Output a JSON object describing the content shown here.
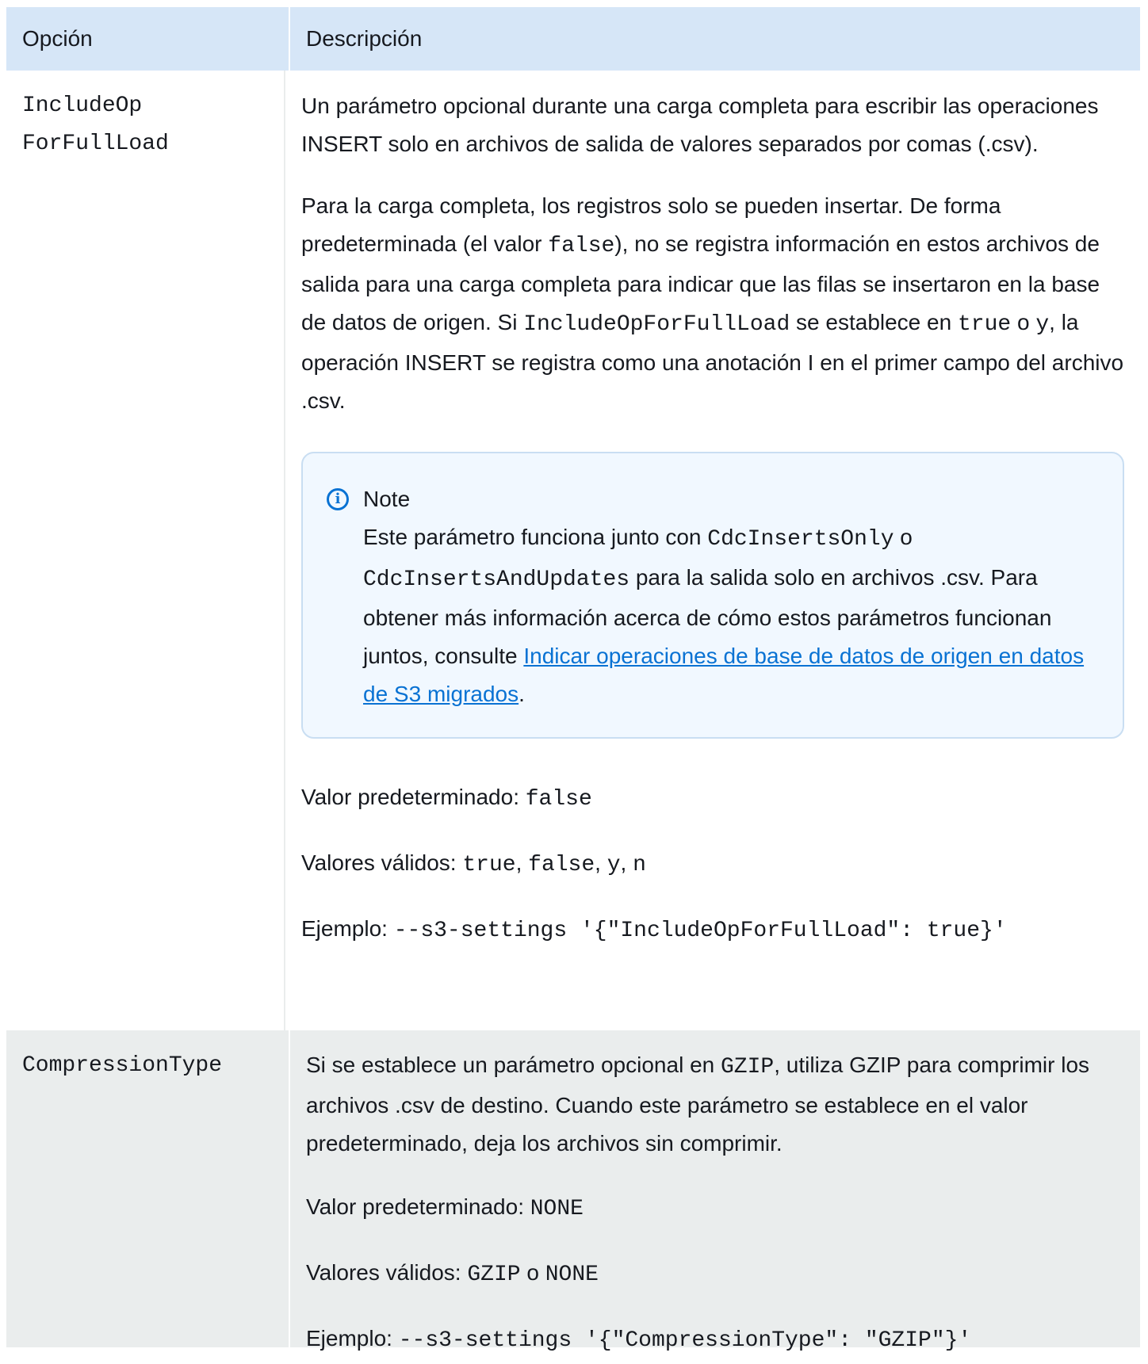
{
  "table": {
    "headers": {
      "option": "Opción",
      "description": "Descripción"
    },
    "rows": [
      {
        "option_line1": "IncludeOp",
        "option_line2": "ForFullLoad",
        "p1": "Un parámetro opcional durante una carga completa para escribir las operaciones INSERT solo en archivos de salida de valores separados por comas (.csv).",
        "p2": {
          "t1": "Para la carga completa, los registros solo se pueden insertar. De forma predeterminada (el valor ",
          "c1": "false",
          "t2": "), no se registra información en estos archivos de salida para una carga completa para indicar que las filas se insertaron en la base de datos de origen. Si ",
          "c2": "IncludeOpForFullLoad",
          "t3": " se establece en ",
          "c3": "true",
          "t4": " o ",
          "c4": "y",
          "t5": ", la operación INSERT se registra como una anotación I en el primer campo del archivo .csv."
        },
        "note": {
          "title": "Note",
          "t1": "Este parámetro funciona junto con ",
          "c1": "CdcInsertsOnly",
          "t2": " o ",
          "c2": "CdcInsertsAndUpdates",
          "t3": " para la salida solo en archivos .csv. Para obtener más información acerca de cómo estos parámetros funcionan juntos, consulte ",
          "link": "Indicar operaciones de base de datos de origen en datos de S3 migrados",
          "t4": "."
        },
        "default_label": "Valor predeterminado: ",
        "default_value": "false",
        "valid_label": "Valores válidos: ",
        "valid_v1": "true",
        "valid_v2": "false",
        "valid_v3": "y",
        "valid_v4": "n",
        "example_label": "Ejemplo: ",
        "example_code": "--s3-settings '{\"IncludeOpForFullLoad\": true}'"
      },
      {
        "option": "CompressionType",
        "p1": {
          "t1": "Si se establece un parámetro opcional en ",
          "c1": "GZIP",
          "t2": ", utiliza GZIP para comprimir los archivos .csv de destino. Cuando este parámetro se establece en el valor predeterminado, deja los archivos sin comprimir."
        },
        "default_label": "Valor predeterminado: ",
        "default_value": "NONE",
        "valid_label": "Valores válidos: ",
        "valid_v1": "GZIP",
        "valid_sep": " o ",
        "valid_v2": "NONE",
        "example_label": "Ejemplo: ",
        "example_code": "--s3-settings '{\"CompressionType\": \"GZIP\"}'"
      }
    ]
  },
  "colors": {
    "header_bg": "#d6e6f7",
    "alt_row_bg": "#eaeded",
    "note_bg": "#f1f8ff",
    "link": "#0972d3"
  },
  "icons": {
    "note_icon": "info-circle-icon"
  }
}
